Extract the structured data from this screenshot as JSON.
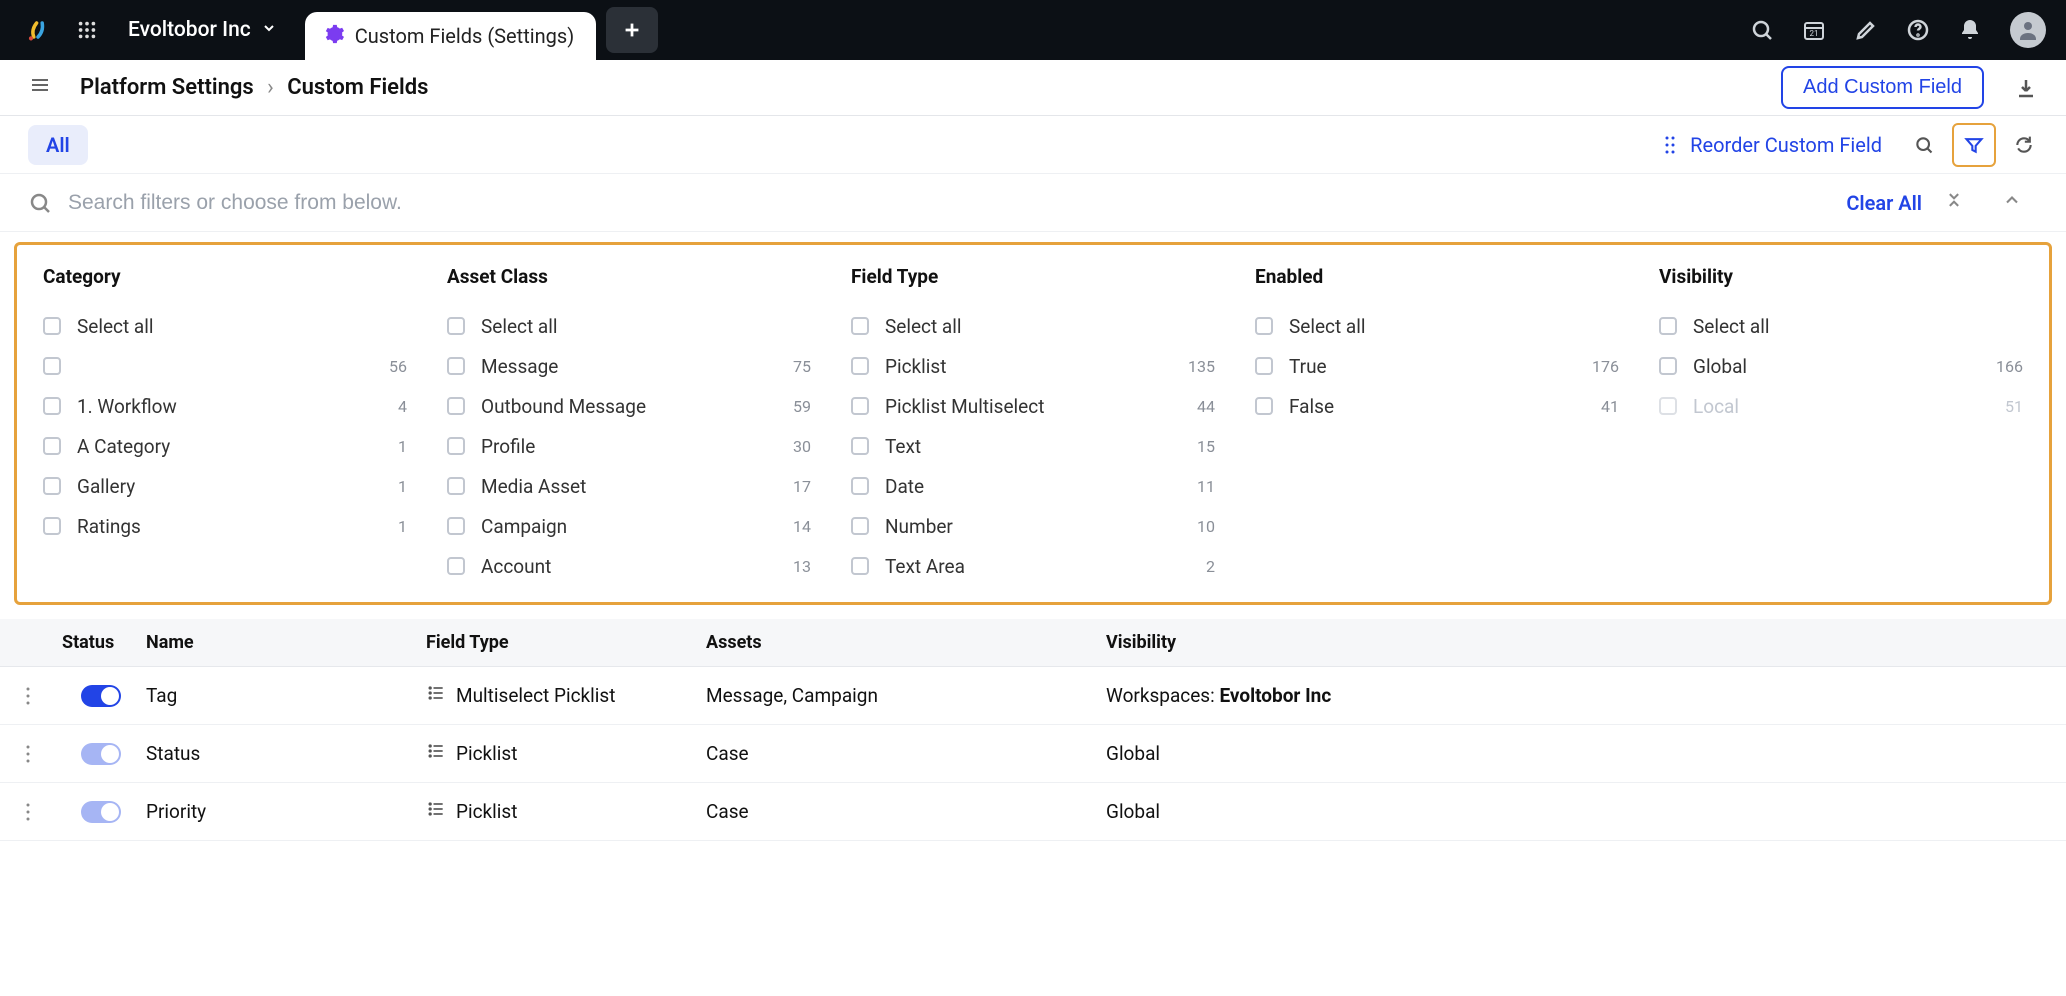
{
  "topbar": {
    "workspace": "Evoltobor Inc",
    "active_tab": "Custom Fields (Settings)"
  },
  "header": {
    "breadcrumb_parent": "Platform Settings",
    "breadcrumb_current": "Custom Fields",
    "add_button": "Add Custom Field"
  },
  "toolbar": {
    "chip_all": "All",
    "reorder": "Reorder Custom Field"
  },
  "filter_search": {
    "placeholder": "Search filters or choose from below.",
    "clear_all": "Clear All"
  },
  "filters": {
    "category": {
      "title": "Category",
      "select_all": "Select all",
      "items": [
        {
          "label": "",
          "count": "56"
        },
        {
          "label": "1. Workflow",
          "count": "4"
        },
        {
          "label": "A Category",
          "count": "1"
        },
        {
          "label": "Gallery",
          "count": "1"
        },
        {
          "label": "Ratings",
          "count": "1"
        }
      ]
    },
    "asset_class": {
      "title": "Asset Class",
      "select_all": "Select all",
      "items": [
        {
          "label": "Message",
          "count": "75"
        },
        {
          "label": "Outbound Message",
          "count": "59"
        },
        {
          "label": "Profile",
          "count": "30"
        },
        {
          "label": "Media Asset",
          "count": "17"
        },
        {
          "label": "Campaign",
          "count": "14"
        },
        {
          "label": "Account",
          "count": "13"
        }
      ]
    },
    "field_type": {
      "title": "Field Type",
      "select_all": "Select all",
      "items": [
        {
          "label": "Picklist",
          "count": "135"
        },
        {
          "label": "Picklist Multiselect",
          "count": "44"
        },
        {
          "label": "Text",
          "count": "15"
        },
        {
          "label": "Date",
          "count": "11"
        },
        {
          "label": "Number",
          "count": "10"
        },
        {
          "label": "Text Area",
          "count": "2"
        }
      ]
    },
    "enabled": {
      "title": "Enabled",
      "select_all": "Select all",
      "items": [
        {
          "label": "True",
          "count": "176"
        },
        {
          "label": "False",
          "count": "41"
        }
      ]
    },
    "visibility": {
      "title": "Visibility",
      "select_all": "Select all",
      "items": [
        {
          "label": "Global",
          "count": "166"
        },
        {
          "label": "Local",
          "count": "51",
          "disabled": true
        }
      ]
    }
  },
  "table": {
    "columns": {
      "status": "Status",
      "name": "Name",
      "field_type": "Field Type",
      "assets": "Assets",
      "visibility": "Visibility"
    },
    "rows": [
      {
        "name": "Tag",
        "field_type": "Multiselect Picklist",
        "assets": "Message, Campaign",
        "visibility_prefix": "Workspaces: ",
        "visibility_bold": "Evoltobor Inc",
        "toggle": "on-dark"
      },
      {
        "name": "Status",
        "field_type": "Picklist",
        "assets": "Case",
        "visibility_prefix": "Global",
        "visibility_bold": "",
        "toggle": "on-light"
      },
      {
        "name": "Priority",
        "field_type": "Picklist",
        "assets": "Case",
        "visibility_prefix": "Global",
        "visibility_bold": "",
        "toggle": "on-light"
      }
    ]
  }
}
